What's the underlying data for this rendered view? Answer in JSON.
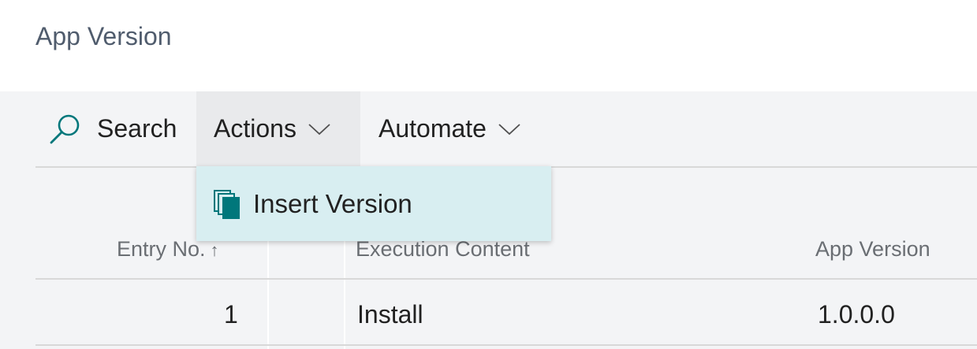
{
  "page": {
    "title": "App Version"
  },
  "toolbar": {
    "search_label": "Search",
    "actions_label": "Actions",
    "automate_label": "Automate"
  },
  "actions_menu": {
    "items": [
      {
        "label": "Insert Version",
        "icon": "copy-pages-icon"
      }
    ]
  },
  "table": {
    "columns": [
      "Entry No.",
      "Execution Content",
      "App Version"
    ],
    "sort_indicator": "↑",
    "rows": [
      {
        "entry_no": "1",
        "execution_content": "Install",
        "app_version": "1.0.0.0"
      }
    ]
  },
  "colors": {
    "accent": "#00777b",
    "dropdown_bg": "#d8eef1",
    "content_bg": "#f3f4f6"
  }
}
